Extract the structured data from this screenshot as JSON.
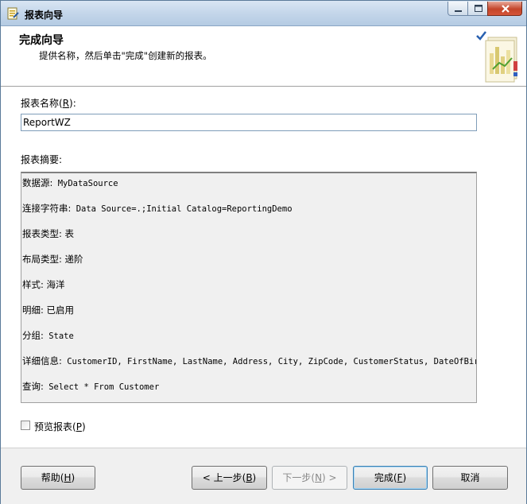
{
  "window": {
    "title": "报表向导"
  },
  "header": {
    "title": "完成向导",
    "subtitle": "提供名称，然后单击\"完成\"创建新的报表。"
  },
  "form": {
    "name_label_pre": "报表名称(",
    "name_label_key": "R",
    "name_label_post": "):",
    "name_value": "ReportWZ",
    "summary_label": "报表摘要:",
    "summary": [
      {
        "label": "数据源:",
        "value": " MyDataSource"
      },
      {
        "label": "连接字符串:",
        "value": " Data Source=.;Initial Catalog=ReportingDemo"
      },
      {
        "label": "报表类型:",
        "value": " 表"
      },
      {
        "label": "布局类型:",
        "value": " 递阶"
      },
      {
        "label": "样式:",
        "value": " 海洋"
      },
      {
        "label": "明细:",
        "value": " 已启用"
      },
      {
        "label": "分组:",
        "value": " State"
      },
      {
        "label": "详细信息:",
        "value": " CustomerID, FirstName, LastName, Address, City, ZipCode, CustomerStatus, DateOfBirth"
      },
      {
        "label": "查询:",
        "value": "  Select * From Customer"
      }
    ],
    "preview_label_pre": "预览报表(",
    "preview_label_key": "P",
    "preview_label_post": ")",
    "preview_checked": false
  },
  "buttons": {
    "help": {
      "pre": "帮助(",
      "key": "H",
      "post": ")"
    },
    "back": {
      "pre": "< 上一步(",
      "key": "B",
      "post": ")"
    },
    "next": {
      "pre": "下一步(",
      "key": "N",
      "post": ") >"
    },
    "finish": {
      "pre": "完成(",
      "key": "F",
      "post": ")"
    },
    "cancel": {
      "label": "取消"
    }
  }
}
